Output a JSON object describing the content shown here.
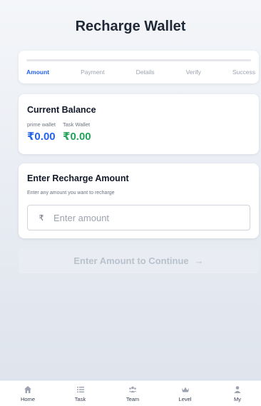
{
  "header": {
    "title": "Recharge Wallet"
  },
  "stepper": {
    "progress": 0,
    "steps": [
      "Amount",
      "Payment",
      "Details",
      "Verify",
      "Success"
    ],
    "active_index": 0
  },
  "balance": {
    "heading": "Current Balance",
    "prime_wallet": {
      "label": "prime wallet",
      "value": "₹0.00"
    },
    "task_wallet": {
      "label": "Task Wallet",
      "value": "₹0.00"
    }
  },
  "recharge": {
    "heading": "Enter Recharge Amount",
    "hint": "Enter any amount you want to recharge",
    "currency_symbol": "₹",
    "amount_value": "",
    "placeholder": "Enter amount"
  },
  "continue_button": {
    "label": "Enter Amount to Continue",
    "arrow": "→"
  },
  "bottom_nav": [
    {
      "label": "Home",
      "icon": "home-icon"
    },
    {
      "label": "Task",
      "icon": "list-icon"
    },
    {
      "label": "Team",
      "icon": "team-icon"
    },
    {
      "label": "Level",
      "icon": "crown-icon"
    },
    {
      "label": "My",
      "icon": "user-icon"
    }
  ],
  "colors": {
    "accent": "#2563eb",
    "prime_value": "#2563eb",
    "task_value": "#22a35a",
    "disabled_button": "#e9edf3"
  }
}
